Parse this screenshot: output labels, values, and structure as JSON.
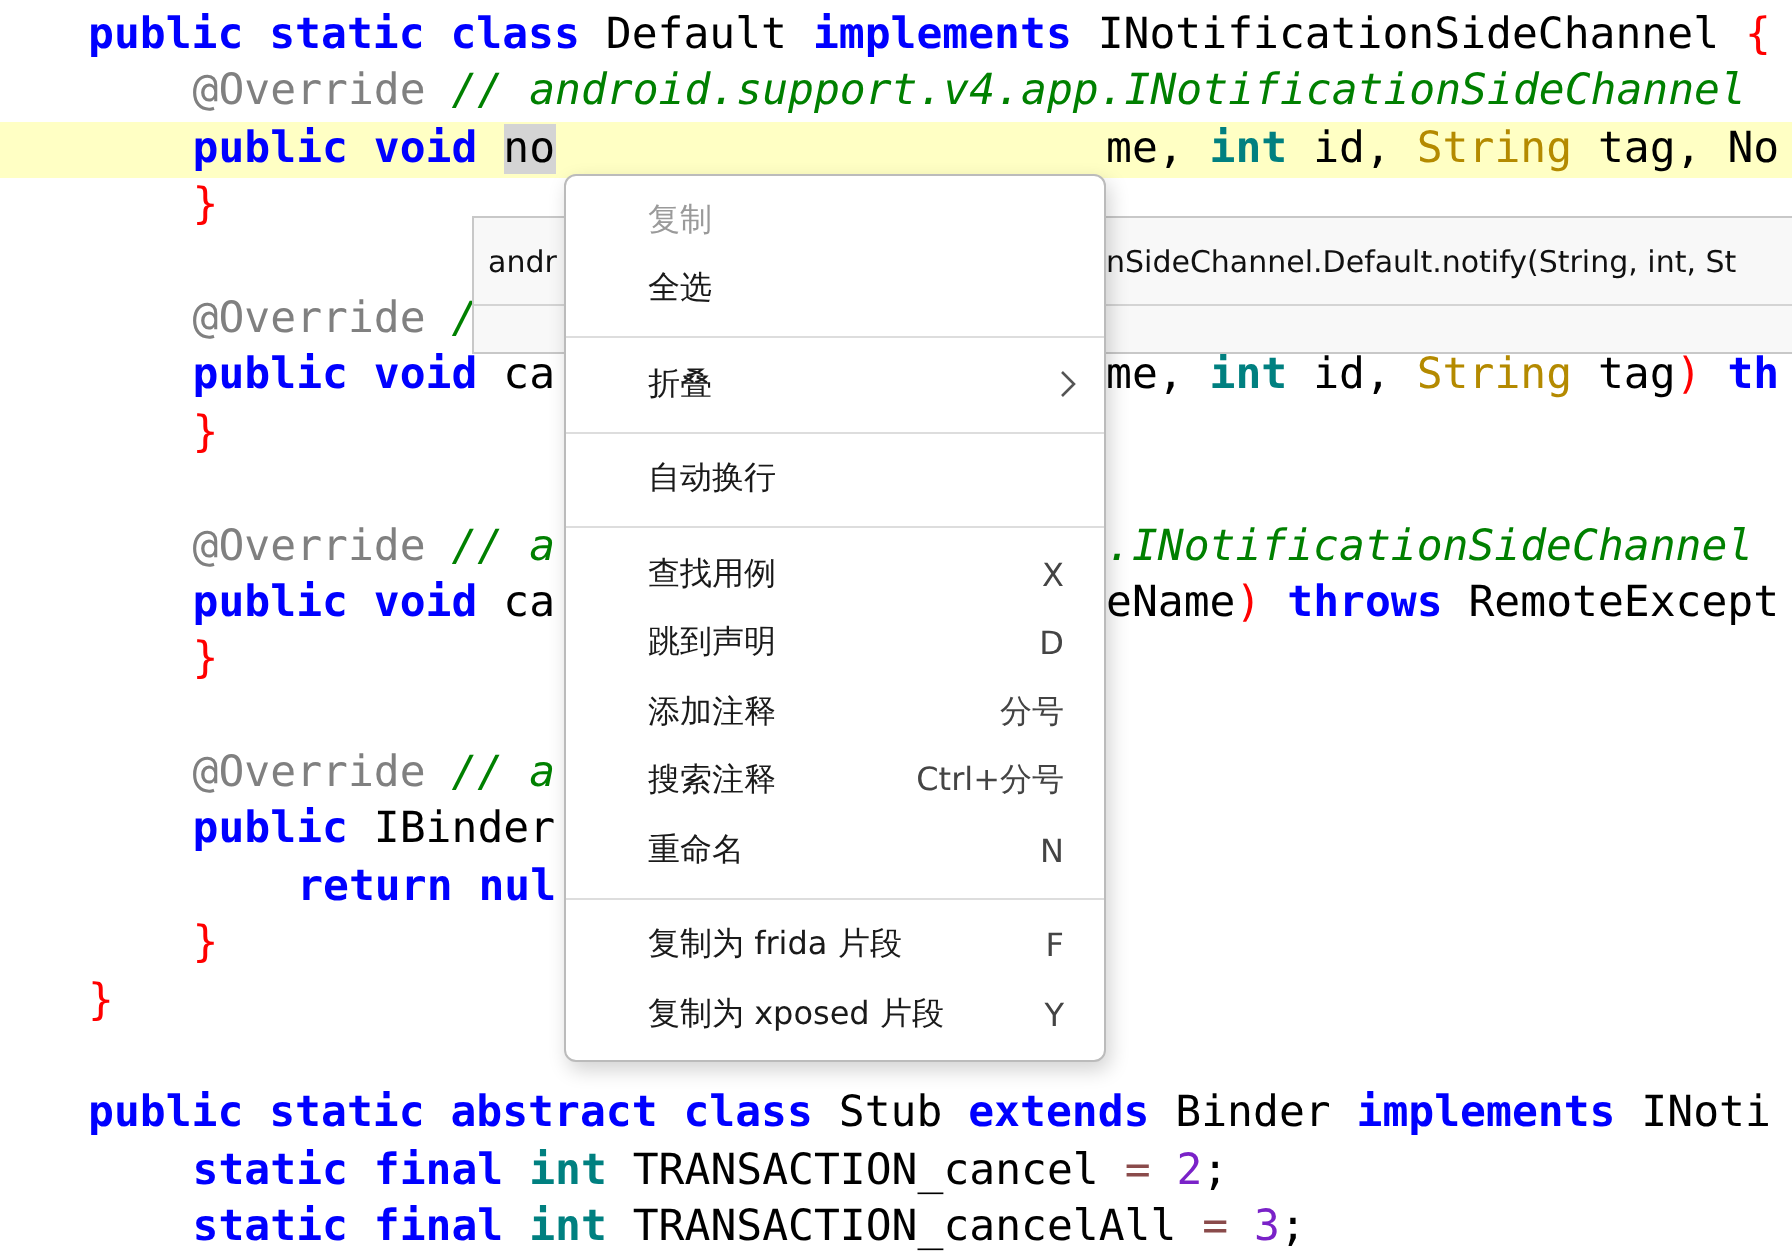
{
  "editor": {
    "lines": [
      {
        "highlighted": false,
        "blank_before": false,
        "tokens": [
          {
            "kind": "keyword",
            "text": "public static class"
          },
          {
            "kind": "plain",
            "text": " Default "
          },
          {
            "kind": "keyword",
            "text": "implements"
          },
          {
            "kind": "plain",
            "text": " INotificationSideChannel "
          },
          {
            "kind": "brace",
            "text": "{"
          }
        ],
        "children": [
          {
            "highlighted": false,
            "blank_before": false,
            "tokens": [
              {
                "kind": "annotation",
                "text": "@Override"
              },
              {
                "kind": "comment",
                "text": " // android.support.v4.app.INotificationSideChannel"
              }
            ]
          },
          {
            "highlighted": true,
            "blank_before": false,
            "tokens": [
              {
                "kind": "keyword",
                "text": "public void "
              },
              {
                "kind": "selected",
                "text": "no"
              }
            ],
            "tail": [
              {
                "kind": "plain",
                "text": "me, "
              },
              {
                "kind": "primitive",
                "text": "int"
              },
              {
                "kind": "plain",
                "text": " id, "
              },
              {
                "kind": "class",
                "text": "String"
              },
              {
                "kind": "plain",
                "text": " tag, No"
              }
            ]
          },
          {
            "highlighted": false,
            "blank_before": false,
            "tokens": [
              {
                "kind": "brace",
                "text": "}"
              }
            ]
          },
          {
            "highlighted": false,
            "blank_before": true,
            "tokens": [
              {
                "kind": "annotation",
                "text": "@Override"
              },
              {
                "kind": "comment",
                "text": " /"
              }
            ]
          },
          {
            "highlighted": false,
            "blank_before": false,
            "tokens": [
              {
                "kind": "keyword",
                "text": "public void"
              },
              {
                "kind": "plain",
                "text": " ca"
              }
            ],
            "tail": [
              {
                "kind": "plain",
                "text": "me, "
              },
              {
                "kind": "primitive",
                "text": "int"
              },
              {
                "kind": "plain",
                "text": " id, "
              },
              {
                "kind": "class",
                "text": "String"
              },
              {
                "kind": "plain",
                "text": " tag"
              },
              {
                "kind": "brace",
                "text": ")"
              },
              {
                "kind": "keyword",
                "text": " th"
              }
            ]
          },
          {
            "highlighted": false,
            "blank_before": false,
            "tokens": [
              {
                "kind": "brace",
                "text": "}"
              }
            ]
          },
          {
            "highlighted": false,
            "blank_before": true,
            "tokens": [
              {
                "kind": "annotation",
                "text": "@Override"
              },
              {
                "kind": "comment",
                "text": " // a"
              }
            ],
            "tail": [
              {
                "kind": "comment",
                "text": ".INotificationSideChannel"
              }
            ]
          },
          {
            "highlighted": false,
            "blank_before": false,
            "tokens": [
              {
                "kind": "keyword",
                "text": "public void"
              },
              {
                "kind": "plain",
                "text": " ca"
              }
            ],
            "tail": [
              {
                "kind": "plain",
                "text": "eName"
              },
              {
                "kind": "brace",
                "text": ")"
              },
              {
                "kind": "keyword",
                "text": " throws"
              },
              {
                "kind": "plain",
                "text": " RemoteExcept"
              }
            ]
          },
          {
            "highlighted": false,
            "blank_before": false,
            "tokens": [
              {
                "kind": "brace",
                "text": "}"
              }
            ]
          },
          {
            "highlighted": false,
            "blank_before": true,
            "tokens": [
              {
                "kind": "annotation",
                "text": "@Override"
              },
              {
                "kind": "comment",
                "text": " // a"
              }
            ]
          },
          {
            "highlighted": false,
            "blank_before": false,
            "tokens": [
              {
                "kind": "keyword",
                "text": "public"
              },
              {
                "kind": "plain",
                "text": " IBinder"
              }
            ],
            "children": [
              {
                "highlighted": false,
                "blank_before": false,
                "tokens": [
                  {
                    "kind": "keyword",
                    "text": "return nul"
                  }
                ]
              }
            ]
          },
          {
            "highlighted": false,
            "blank_before": false,
            "tokens": [
              {
                "kind": "brace",
                "text": "}"
              }
            ]
          }
        ]
      },
      {
        "highlighted": false,
        "blank_before": false,
        "tokens": [
          {
            "kind": "brace",
            "text": "}"
          }
        ]
      },
      {
        "highlighted": false,
        "blank_before": true,
        "tokens": [
          {
            "kind": "keyword",
            "text": "public static abstract class"
          },
          {
            "kind": "plain",
            "text": " Stub "
          },
          {
            "kind": "keyword",
            "text": "extends"
          },
          {
            "kind": "plain",
            "text": " Binder "
          },
          {
            "kind": "keyword",
            "text": "implements"
          },
          {
            "kind": "plain",
            "text": " INoti"
          }
        ],
        "children": [
          {
            "highlighted": false,
            "blank_before": false,
            "tokens": [
              {
                "kind": "keyword",
                "text": "static final"
              },
              {
                "kind": "primitive",
                "text": " int"
              },
              {
                "kind": "plain",
                "text": " TRANSACTION_cancel "
              },
              {
                "kind": "operator",
                "text": "="
              },
              {
                "kind": "number",
                "text": " 2"
              },
              {
                "kind": "plain",
                "text": ";"
              }
            ]
          },
          {
            "highlighted": false,
            "blank_before": false,
            "tokens": [
              {
                "kind": "keyword",
                "text": "static final"
              },
              {
                "kind": "primitive",
                "text": " int"
              },
              {
                "kind": "plain",
                "text": " TRANSACTION_cancelAll "
              },
              {
                "kind": "operator",
                "text": "="
              },
              {
                "kind": "number",
                "text": " 3"
              },
              {
                "kind": "plain",
                "text": ";"
              }
            ]
          }
        ]
      }
    ]
  },
  "tooltip": {
    "segments": [
      "andr",
      "nSideChannel.Default.notify(String, int, St"
    ]
  },
  "context_menu": {
    "items": [
      {
        "kind": "item",
        "label": "复制",
        "disabled": true,
        "submenu": false
      },
      {
        "kind": "item",
        "label": "全选",
        "disabled": false,
        "submenu": false
      },
      {
        "kind": "separator"
      },
      {
        "kind": "item",
        "label": "折叠",
        "disabled": false,
        "submenu": true
      },
      {
        "kind": "separator"
      },
      {
        "kind": "item",
        "label": "自动换行",
        "disabled": false,
        "submenu": false
      },
      {
        "kind": "separator"
      },
      {
        "kind": "item",
        "label": "查找用例",
        "shortcut": "X",
        "disabled": false,
        "submenu": false
      },
      {
        "kind": "item",
        "label": "跳到声明",
        "shortcut": "D",
        "disabled": false,
        "submenu": false
      },
      {
        "kind": "item",
        "label": "添加注释",
        "shortcut": "分号",
        "disabled": false,
        "submenu": false
      },
      {
        "kind": "item",
        "label": "搜索注释",
        "shortcut": "Ctrl+分号",
        "disabled": false,
        "submenu": false
      },
      {
        "kind": "item",
        "label": "重命名",
        "shortcut": "N",
        "disabled": false,
        "submenu": false
      },
      {
        "kind": "separator"
      },
      {
        "kind": "item",
        "label": "复制为 frida 片段",
        "shortcut": "F",
        "disabled": false,
        "submenu": false
      },
      {
        "kind": "item",
        "label": "复制为 xposed 片段",
        "shortcut": "Y",
        "disabled": false,
        "submenu": false
      }
    ]
  }
}
